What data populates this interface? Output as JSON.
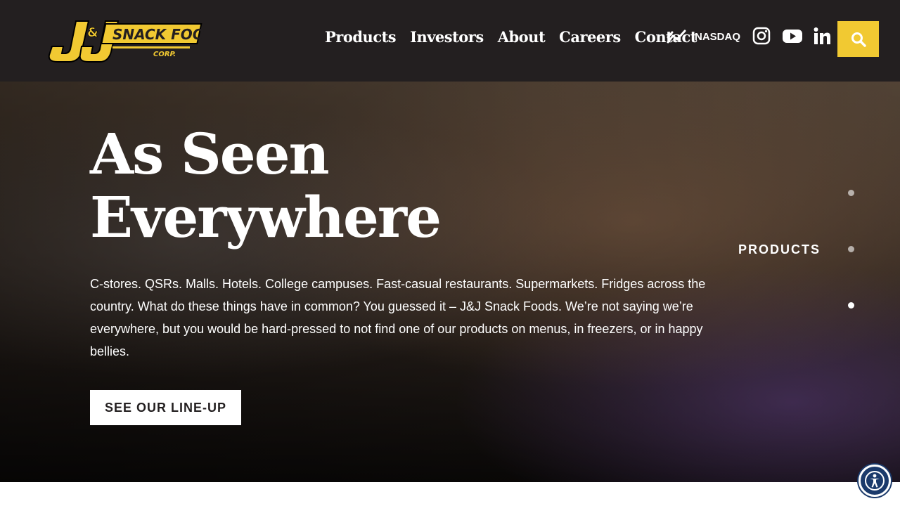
{
  "header": {
    "logo_text": "J&J SNACK FOODS CORP.",
    "nav": [
      {
        "label": "Products"
      },
      {
        "label": "Investors"
      },
      {
        "label": "About"
      },
      {
        "label": "Careers"
      },
      {
        "label": "Contact"
      }
    ],
    "ticker_label": "NASDAQ",
    "ticker_icon": "trend-chart-icon",
    "social": [
      {
        "name": "instagram-icon"
      },
      {
        "name": "youtube-icon"
      },
      {
        "name": "linkedin-icon"
      }
    ],
    "search_icon": "search-icon"
  },
  "hero": {
    "title": "As Seen Everywhere",
    "description": "C-stores. QSRs. Malls. Hotels. College campuses. Fast-casual restaurants. Supermarkets. Fridges across the country. What do these things have in common? You guessed it – J&J Snack Foods. We’re not saying we’re everywhere, but you would be hard-pressed to not find one of our products on menus, in freezers, or in happy bellies.",
    "cta_label": "SEE OUR LINE-UP"
  },
  "slider": {
    "active_label": "PRODUCTS",
    "slide_count": 3,
    "active_index": 1
  },
  "colors": {
    "header_bg": "#231f20",
    "accent_yellow": "#f1c932",
    "accessibility_blue": "#1b3a6b"
  }
}
